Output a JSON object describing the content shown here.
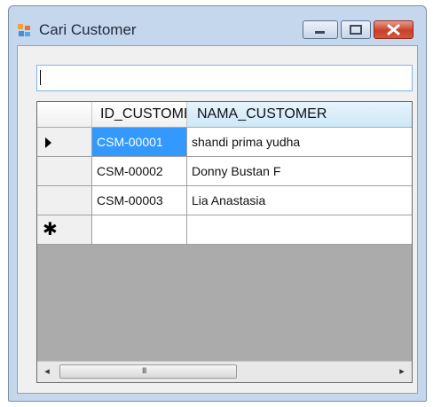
{
  "window": {
    "title": "Cari Customer",
    "icons": {
      "app": "form-icon",
      "minimize": "minimize-icon",
      "maximize": "maximize-icon",
      "close": "close-icon"
    }
  },
  "search": {
    "value": ""
  },
  "grid": {
    "columns": [
      "ID_CUSTOMER",
      "NAMA_CUSTOMER"
    ],
    "rows": [
      {
        "id": "CSM-00001",
        "nama": "shandi prima yudha"
      },
      {
        "id": "CSM-00002",
        "nama": "Donny Bustan F"
      },
      {
        "id": "CSM-00003",
        "nama": "Lia Anastasia"
      }
    ],
    "selected_row": 0,
    "current_row_indicator": "▶",
    "new_row_indicator": "✱",
    "scrollbar": {
      "left_arrow": "◂",
      "right_arrow": "▸",
      "grip": "III"
    }
  },
  "colors": {
    "selection": "#3399ff",
    "grid_background": "#ababab",
    "window_frame": "#c5d7ed"
  }
}
